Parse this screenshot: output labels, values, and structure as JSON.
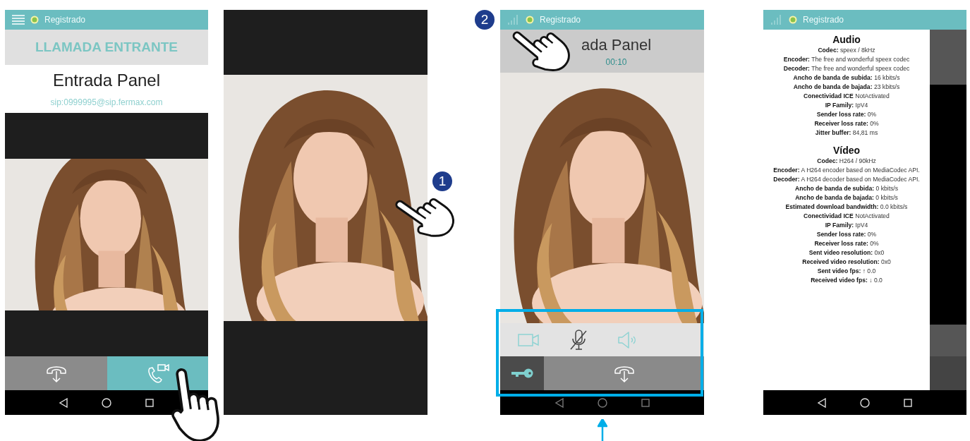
{
  "incoming_call": {
    "status": "Registrado",
    "title": "LLAMADA ENTRANTE",
    "caller": "Entrada Panel",
    "address": "sip:0999995@sip.fermax.com",
    "actions": [
      {
        "kind": "hangup"
      },
      {
        "kind": "video_answer"
      }
    ]
  },
  "fullscreen_video": {
    "step": "1"
  },
  "in_call": {
    "step": "2",
    "status": "Registrado",
    "caller": "ada Panel",
    "duration": "00:10",
    "controls": [
      {
        "kind": "camera",
        "on": true
      },
      {
        "kind": "mic",
        "on": false
      },
      {
        "kind": "speaker",
        "on": true
      }
    ],
    "actions": [
      {
        "kind": "door_key"
      },
      {
        "kind": "hangup"
      }
    ]
  },
  "call_stats": {
    "status": "Registrado",
    "sections": [
      {
        "title": "Audio",
        "lines": [
          "**Codec:** speex / 8kHz",
          "**Encoder:** The free and wonderful speex codec",
          "**Decoder:** The free and wonderful speex codec",
          "**Ancho de banda de subida:** 16 kbits/s",
          "**Ancho de banda de bajada:** 23 kbits/s",
          "**Conectividad ICE** NotActivated",
          "**IP Family:** IpV4",
          "**Sender loss rate:** 0%",
          "**Receiver loss rate:** 0%",
          "**Jitter buffer:** 84,81 ms"
        ]
      },
      {
        "title": "Vídeo",
        "lines": [
          "**Codec:** H264 / 90kHz",
          "**Encoder:** A H264 encoder based on MediaCodec API.",
          "**Decoder:** A H264 decoder based on MediaCodec API.",
          "**Ancho de banda de subida:** 0 kbits/s",
          "**Ancho de banda de bajada:** 0 kbits/s",
          "**Estimated download bandwidth:** 0.0 kbits/s",
          "**Conectividad ICE** NotActivated",
          "**IP Family:** IpV4",
          "**Sender loss rate:** 0%",
          "**Receiver loss rate:** 0%",
          "**Sent video resolution:** 0x0",
          "**Received video resolution:** 0x0",
          "**Sent video fps:** ↑ 0.0",
          "**Received video fps:** ↓ 0.0"
        ]
      }
    ]
  }
}
